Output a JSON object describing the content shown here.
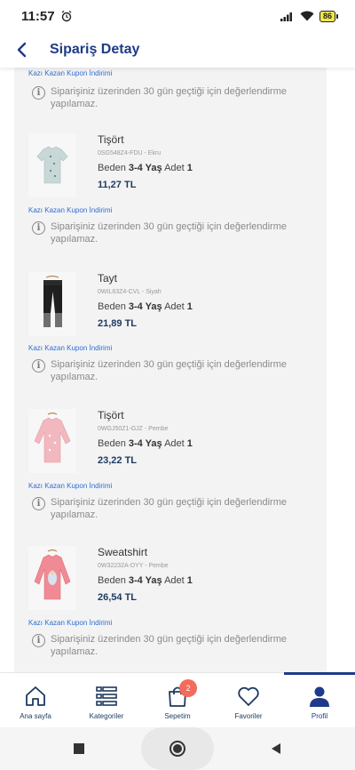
{
  "status_bar": {
    "time": "11:57",
    "battery": "86"
  },
  "header": {
    "title": "Sipariş Detay"
  },
  "coupon_label": "Kazı Kazan Kupon İndirimi",
  "review_notice": "Siparişiniz üzerinden 30 gün geçtiği için değerlendirme yapılamaz.",
  "products": [
    {
      "name": "Tişört",
      "code": "0SG548Z4-FDU - Ekru",
      "size_label": "Beden",
      "size": "3-4 Yaş",
      "qty_label": "Adet",
      "qty": "1",
      "price": "11,27 TL",
      "image_icon": "tshirt-ecru"
    },
    {
      "name": "Tayt",
      "code": "0WIL63Z4-CVL - Siyah",
      "size_label": "Beden",
      "size": "3-4 Yaş",
      "qty_label": "Adet",
      "qty": "1",
      "price": "21,89 TL",
      "image_icon": "leggings-black"
    },
    {
      "name": "Tişört",
      "code": "0WGJ50Z1-GJZ - Pembe",
      "size_label": "Beden",
      "size": "3-4 Yaş",
      "qty_label": "Adet",
      "qty": "1",
      "price": "23,22 TL",
      "image_icon": "tshirt-pink"
    },
    {
      "name": "Sweatshirt",
      "code": "0W32232A-DYY - Pembe",
      "size_label": "Beden",
      "size": "3-4 Yaş",
      "qty_label": "Adet",
      "qty": "1",
      "price": "26,54 TL",
      "image_icon": "sweatshirt-pink"
    }
  ],
  "bottom_nav": [
    {
      "label": "Ana sayfa",
      "icon": "home-icon"
    },
    {
      "label": "Kategoriler",
      "icon": "list-icon"
    },
    {
      "label": "Sepetim",
      "icon": "bag-icon",
      "badge": "2"
    },
    {
      "label": "Favoriler",
      "icon": "heart-icon"
    },
    {
      "label": "Profil",
      "icon": "user-icon",
      "active": true
    }
  ],
  "colors": {
    "brand": "#1e3a8a",
    "link": "#2f6fd1",
    "badge": "#f26b5b"
  }
}
